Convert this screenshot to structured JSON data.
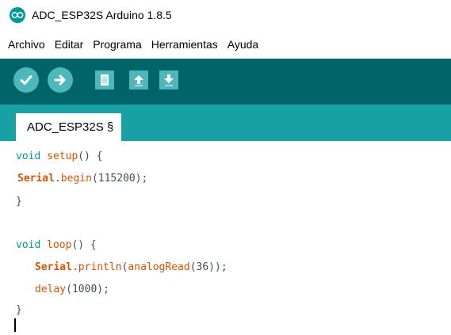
{
  "window": {
    "title": "ADC_ESP32S Arduino 1.8.5",
    "icon": "arduino-logo-icon"
  },
  "menu": [
    "Archivo",
    "Editar",
    "Programa",
    "Herramientas",
    "Ayuda"
  ],
  "toolbar": {
    "buttons": [
      {
        "name": "verify",
        "icon": "check-icon"
      },
      {
        "name": "upload",
        "icon": "arrow-right-icon"
      },
      {
        "name": "new",
        "icon": "new-file-icon"
      },
      {
        "name": "open",
        "icon": "arrow-up-icon"
      },
      {
        "name": "save",
        "icon": "arrow-down-icon"
      }
    ]
  },
  "tab": {
    "label": "ADC_ESP32S §"
  },
  "code": {
    "line1": {
      "kw": "void",
      "fn": "setup",
      "rest": "() {"
    },
    "line2": {
      "cls": "Serial",
      "dot": ".",
      "fn": "begin",
      "rest": "(115200);"
    },
    "line3": {
      "text": "}"
    },
    "line5": {
      "kw": "void",
      "fn": "loop",
      "rest": "() {"
    },
    "line6": {
      "cls": "Serial",
      "dot": ".",
      "fn": "println",
      "open": "(",
      "fn2": "analogRead",
      "rest": "(36));"
    },
    "line7": {
      "fn": "delay",
      "rest": "(1000);"
    },
    "line8": {
      "text": "}"
    }
  },
  "colors": {
    "toolbar": "#006468",
    "tabbar": "#17a1a5",
    "button": "#4db7bb",
    "keyword": "#00979c",
    "function": "#d35400"
  }
}
